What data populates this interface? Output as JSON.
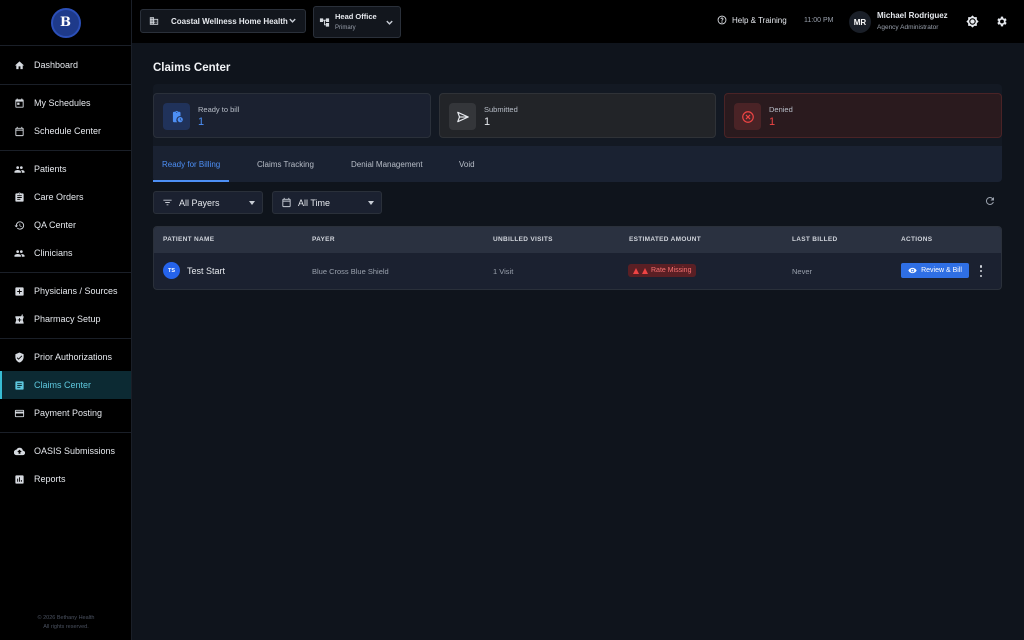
{
  "brand": {
    "logo_text": "B"
  },
  "sidebar": {
    "items": [
      {
        "label": "Dashboard",
        "icon": "home-icon"
      },
      {
        "label": "My Schedules",
        "icon": "calendar-check-icon"
      },
      {
        "label": "Schedule Center",
        "icon": "calendar-icon"
      },
      {
        "label": "Patients",
        "icon": "people-icon"
      },
      {
        "label": "Care Orders",
        "icon": "clipboard-icon"
      },
      {
        "label": "QA Center",
        "icon": "history-icon"
      },
      {
        "label": "Clinicians",
        "icon": "group-icon"
      },
      {
        "label": "Physicians / Sources",
        "icon": "medical-plus-icon"
      },
      {
        "label": "Pharmacy Setup",
        "icon": "pharmacy-icon"
      },
      {
        "label": "Prior Authorizations",
        "icon": "shield-check-icon"
      },
      {
        "label": "Claims Center",
        "icon": "document-list-icon",
        "active": true
      },
      {
        "label": "Payment Posting",
        "icon": "credit-card-icon"
      },
      {
        "label": "OASIS Submissions",
        "icon": "cloud-upload-icon"
      },
      {
        "label": "Reports",
        "icon": "bar-chart-icon"
      }
    ],
    "copyright_line1": "© 2026 Bethany Health",
    "copyright_line2": "All rights reserved."
  },
  "header": {
    "agency": "Coastal Wellness Home Health",
    "office_name": "Head Office",
    "office_sub": "Primary",
    "help": "Help & Training",
    "time": "11:00 PM",
    "avatar_initials": "MR",
    "user_name": "Michael Rodriguez",
    "user_role": "Agency Administrator"
  },
  "page": {
    "title": "Claims Center"
  },
  "stats": {
    "ready": {
      "label": "Ready to bill",
      "value": "1"
    },
    "submitted": {
      "label": "Submitted",
      "value": "1"
    },
    "denied": {
      "label": "Denied",
      "value": "1"
    }
  },
  "tabs": [
    {
      "label": "Ready for Billing",
      "active": true
    },
    {
      "label": "Claims Tracking"
    },
    {
      "label": "Denial Management"
    },
    {
      "label": "Void"
    }
  ],
  "filters": {
    "payers": "All Payers",
    "time": "All Time"
  },
  "table": {
    "headers": [
      "PATIENT NAME",
      "PAYER",
      "UNBILLED VISITS",
      "ESTIMATED AMOUNT",
      "LAST BILLED",
      "ACTIONS"
    ],
    "rows": [
      {
        "initials": "TS",
        "patient": "Test Start",
        "payer": "Blue Cross Blue Shield",
        "visits": "1 Visit",
        "amount_badge": "Rate Missing",
        "last_billed": "Never",
        "action": "Review & Bill"
      }
    ]
  },
  "colors": {
    "accent": "#4d8ff5",
    "active_nav": "#38bdd4",
    "danger": "#ef4444",
    "background": "#0f141c"
  }
}
